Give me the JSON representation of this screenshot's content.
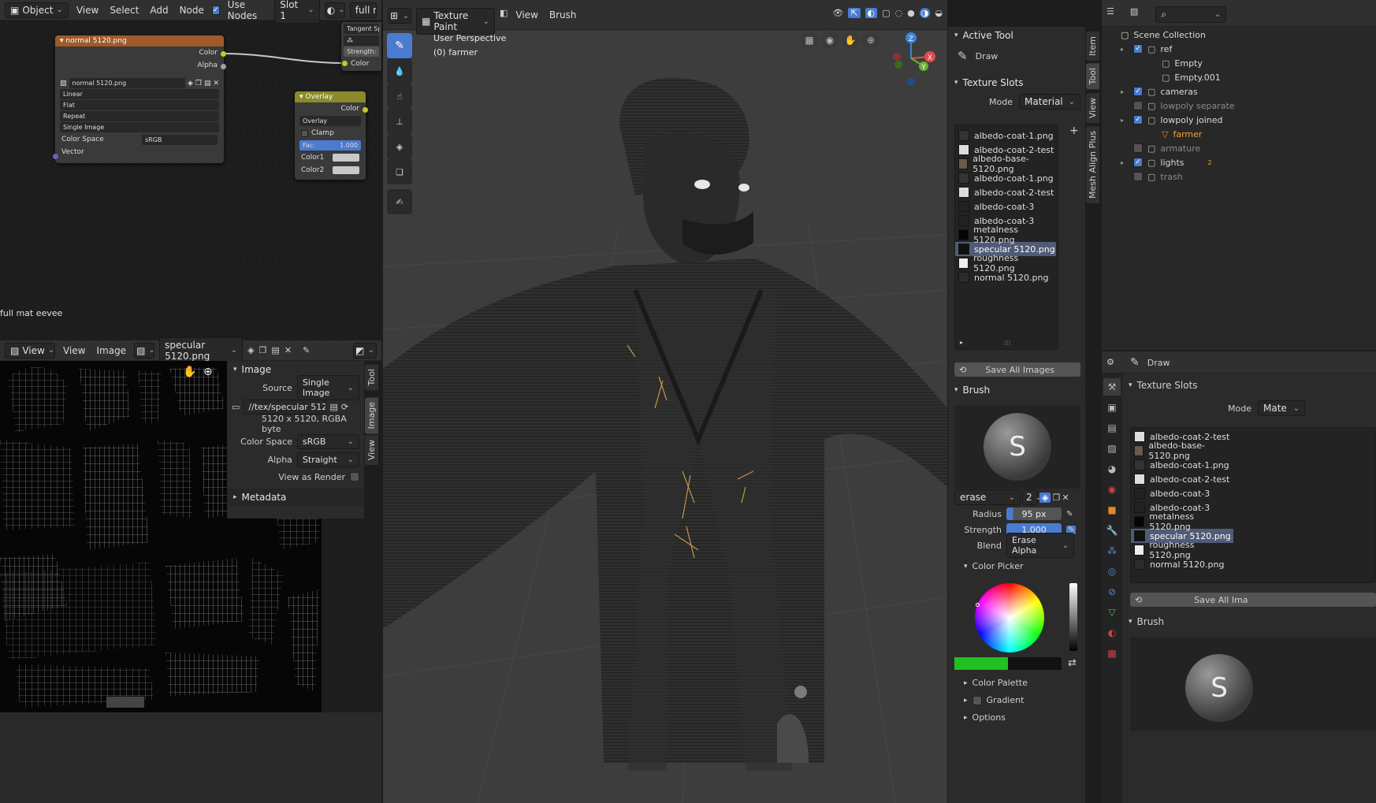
{
  "node_editor": {
    "header": {
      "mode": "Object",
      "menus": [
        "View",
        "Select",
        "Add",
        "Node"
      ],
      "use_nodes_label": "Use Nodes",
      "slot": "Slot 1",
      "material": "full mat"
    },
    "frame_label": "full mat eevee",
    "image_node": {
      "title": "normal 5120.png",
      "outputs": [
        "Color",
        "Alpha"
      ],
      "image_name": "normal 5120.png",
      "interpolation": "Linear",
      "projection": "Flat",
      "extension": "Repeat",
      "source": "Single Image",
      "color_space_label": "Color Space",
      "color_space": "sRGB",
      "input": "Vector"
    },
    "overlay_node": {
      "title": "Overlay",
      "output": "Color",
      "blend": "Overlay",
      "clamp_label": "Clamp",
      "fac_label": "Fac:",
      "fac_value": "1.000",
      "color1": "Color1",
      "color2": "Color2"
    },
    "partial_node": {
      "tangent": "Tangent Sp",
      "strength": "Strength:",
      "color": "Color"
    }
  },
  "image_editor": {
    "header": {
      "view_mode": "View",
      "menus": [
        "View",
        "Image"
      ],
      "image_name": "specular 5120.png"
    },
    "sidebar": {
      "image_section": "Image",
      "source_label": "Source",
      "source": "Single Image",
      "filepath": "//tex/specular 5120...",
      "info": "5120 x 5120,  RGBA byte",
      "color_space_label": "Color Space",
      "color_space": "sRGB",
      "alpha_label": "Alpha",
      "alpha": "Straight",
      "view_as_render_label": "View as Render",
      "metadata_section": "Metadata",
      "tabs": [
        "Tool",
        "Image",
        "View"
      ]
    }
  },
  "viewport": {
    "header": {
      "mode": "Texture Paint",
      "menus": [
        "View",
        "Brush"
      ]
    },
    "overlay_text": {
      "perspective": "User Perspective",
      "object": "(0) farmer"
    },
    "gizmo": {
      "x": "X",
      "y": "Y",
      "z": "Z"
    }
  },
  "tool_panel": {
    "active_tool_section": "Active Tool",
    "active_tool": "Draw",
    "texture_slots_section": "Texture Slots",
    "mode_label": "Mode",
    "mode": "Material",
    "slots": [
      "albedo-coat-1.png",
      "albedo-coat-2-test",
      "albedo-base-5120.png",
      "albedo-coat-1.png",
      "albedo-coat-2-test",
      "albedo-coat-3",
      "albedo-coat-3",
      "metalness 5120.png",
      "specular 5120.png",
      "roughness 5120.png",
      "normal 5120.png"
    ],
    "selected_slot": "specular 5120.png",
    "save_all": "Save All Images",
    "brush_section": "Brush",
    "brush_name": "erase",
    "brush_users": "2",
    "radius_label": "Radius",
    "radius": "95 px",
    "strength_label": "Strength",
    "strength": "1.000",
    "blend_label": "Blend",
    "blend": "Erase Alpha",
    "color_picker_section": "Color Picker",
    "color_palette_section": "Color Palette",
    "gradient_section": "Gradient",
    "options_section": "Options",
    "tabs": [
      "Item",
      "Tool",
      "View",
      "Mesh Align Plus"
    ],
    "accent_color": "#20c020"
  },
  "outliner": {
    "title": "Scene Collection",
    "items": [
      {
        "name": "ref",
        "depth": 1,
        "checked": true
      },
      {
        "name": "Empty",
        "depth": 2,
        "checked": false
      },
      {
        "name": "Empty.001",
        "depth": 2,
        "checked": false
      },
      {
        "name": "cameras",
        "depth": 1,
        "checked": true
      },
      {
        "name": "lowpoly separate",
        "depth": 1,
        "checked": false
      },
      {
        "name": "lowpoly joined",
        "depth": 1,
        "checked": true
      },
      {
        "name": "farmer",
        "depth": 2,
        "checked": false
      },
      {
        "name": "armature",
        "depth": 1,
        "checked": false
      },
      {
        "name": "lights",
        "depth": 1,
        "checked": true
      },
      {
        "name": "trash",
        "depth": 1,
        "checked": false
      }
    ],
    "lights_badge": "2"
  },
  "properties": {
    "active_tool": "Draw",
    "texture_slots_section": "Texture Slots",
    "mode_label": "Mode",
    "mode": "Mate",
    "slots": [
      "albedo-coat-2-test",
      "albedo-base-5120.png",
      "albedo-coat-1.png",
      "albedo-coat-2-test",
      "albedo-coat-3",
      "albedo-coat-3",
      "metalness 5120.png",
      "specular 5120.png",
      "roughness 5120.png",
      "normal 5120.png"
    ],
    "selected_slot": "specular 5120.png",
    "save_all": "Save All Ima",
    "brush_section": "Brush"
  }
}
